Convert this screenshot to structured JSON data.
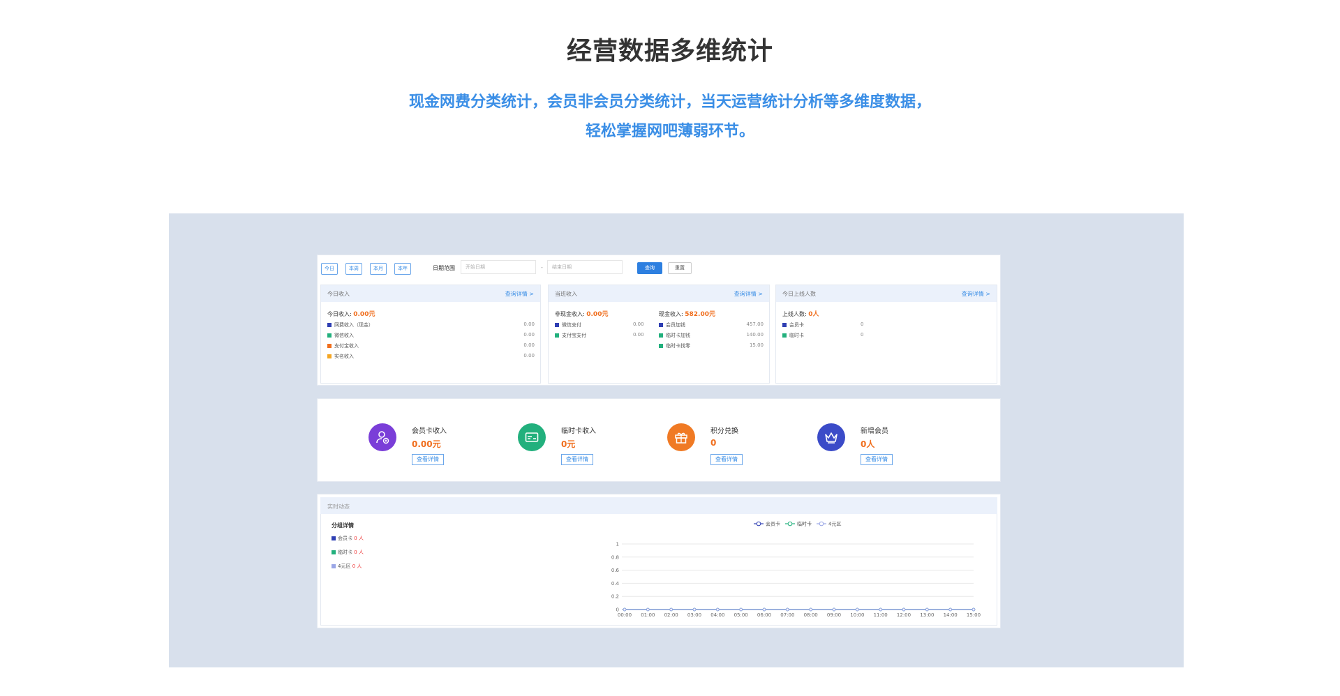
{
  "hero": {
    "title": "经营数据多维统计",
    "subtitle_line1": "现金网费分类统计，会员非会员分类统计，当天运营统计分析等多维度数据，",
    "subtitle_line2": "轻松掌握网吧薄弱环节。"
  },
  "toolbar": {
    "quick_buttons": [
      "今日",
      "本周",
      "本月",
      "本年"
    ],
    "date_range_label": "日期范围",
    "start_placeholder": "开始日期",
    "separator": "-",
    "end_placeholder": "结束日期",
    "query_label": "查询",
    "reset_label": "重置"
  },
  "cards": {
    "today_income": {
      "title": "今日收入",
      "link": "查询详情 >",
      "total_label": "今日收入:",
      "total_value": "0.00元",
      "rows": [
        {
          "label": "网费收入（现金）",
          "value": "0.00",
          "color": "#2f3fb3"
        },
        {
          "label": "微信收入",
          "value": "0.00",
          "color": "#22b07d"
        },
        {
          "label": "支付宝收入",
          "value": "0.00",
          "color": "#f06e1d"
        },
        {
          "label": "实名收入",
          "value": "0.00",
          "color": "#f5a623"
        }
      ]
    },
    "current_income": {
      "title": "当班收入",
      "link": "查询详情 >",
      "noncash_label": "非现金收入:",
      "noncash_value": "0.00元",
      "cash_label": "现金收入:",
      "cash_value": "582.00元",
      "noncash_rows": [
        {
          "label": "微信支付",
          "value": "0.00",
          "color": "#2f3fb3"
        },
        {
          "label": "支付宝支付",
          "value": "0.00",
          "color": "#22b07d"
        }
      ],
      "cash_rows": [
        {
          "label": "会员加钱",
          "value": "457.00",
          "color": "#2f3fb3"
        },
        {
          "label": "临时卡加钱",
          "value": "140.00",
          "color": "#22b07d"
        },
        {
          "label": "临时卡找零",
          "value": "15.00",
          "color": "#22b07d"
        }
      ]
    },
    "online_users": {
      "title": "今日上线人数",
      "link": "查询详情 >",
      "total_label": "上线人数:",
      "total_value": "0人",
      "rows": [
        {
          "label": "会员卡",
          "value": "0",
          "color": "#2f3fb3"
        },
        {
          "label": "临时卡",
          "value": "0",
          "color": "#22b07d"
        }
      ]
    }
  },
  "stats": [
    {
      "label": "会员卡收入",
      "value": "0.00元",
      "button": "查看详情",
      "icon": "member-icon",
      "color": "#7a3ed8"
    },
    {
      "label": "临时卡收入",
      "value": "0元",
      "button": "查看详情",
      "icon": "card-icon",
      "color": "#22b07d"
    },
    {
      "label": "积分兑换",
      "value": "0",
      "button": "查看详情",
      "icon": "gift-icon",
      "color": "#f07a24"
    },
    {
      "label": "新增会员",
      "value": "0人",
      "button": "查看详情",
      "icon": "crown-icon",
      "color": "#3b4bc8"
    }
  ],
  "realtime": {
    "title": "实时动态",
    "group_title": "分组详情",
    "groups": [
      {
        "label": "会员卡",
        "count": "0 人",
        "color": "#2f3fb3"
      },
      {
        "label": "临时卡",
        "count": "0 人",
        "color": "#22b07d"
      },
      {
        "label": "4元区",
        "count": "0 人",
        "color": "#9aa6e6"
      }
    ]
  },
  "chart_data": {
    "type": "line",
    "x": [
      "00:00",
      "01:00",
      "02:00",
      "03:00",
      "04:00",
      "05:00",
      "06:00",
      "07:00",
      "08:00",
      "09:00",
      "10:00",
      "11:00",
      "12:00",
      "13:00",
      "14:00",
      "15:00"
    ],
    "series": [
      {
        "name": "会员卡",
        "values": [
          0,
          0,
          0,
          0,
          0,
          0,
          0,
          0,
          0,
          0,
          0,
          0,
          0,
          0,
          0,
          0
        ],
        "color": "#2f3fb3"
      },
      {
        "name": "临时卡",
        "values": [
          0,
          0,
          0,
          0,
          0,
          0,
          0,
          0,
          0,
          0,
          0,
          0,
          0,
          0,
          0,
          0
        ],
        "color": "#22b07d"
      },
      {
        "name": "4元区",
        "values": [
          0,
          0,
          0,
          0,
          0,
          0,
          0,
          0,
          0,
          0,
          0,
          0,
          0,
          0,
          0,
          0
        ],
        "color": "#9aa6e6"
      }
    ],
    "yticks": [
      "0",
      "0.2",
      "0.4",
      "0.6",
      "0.8",
      "1"
    ],
    "ylim": [
      0,
      1
    ],
    "legend": "top-center",
    "grid": true
  }
}
